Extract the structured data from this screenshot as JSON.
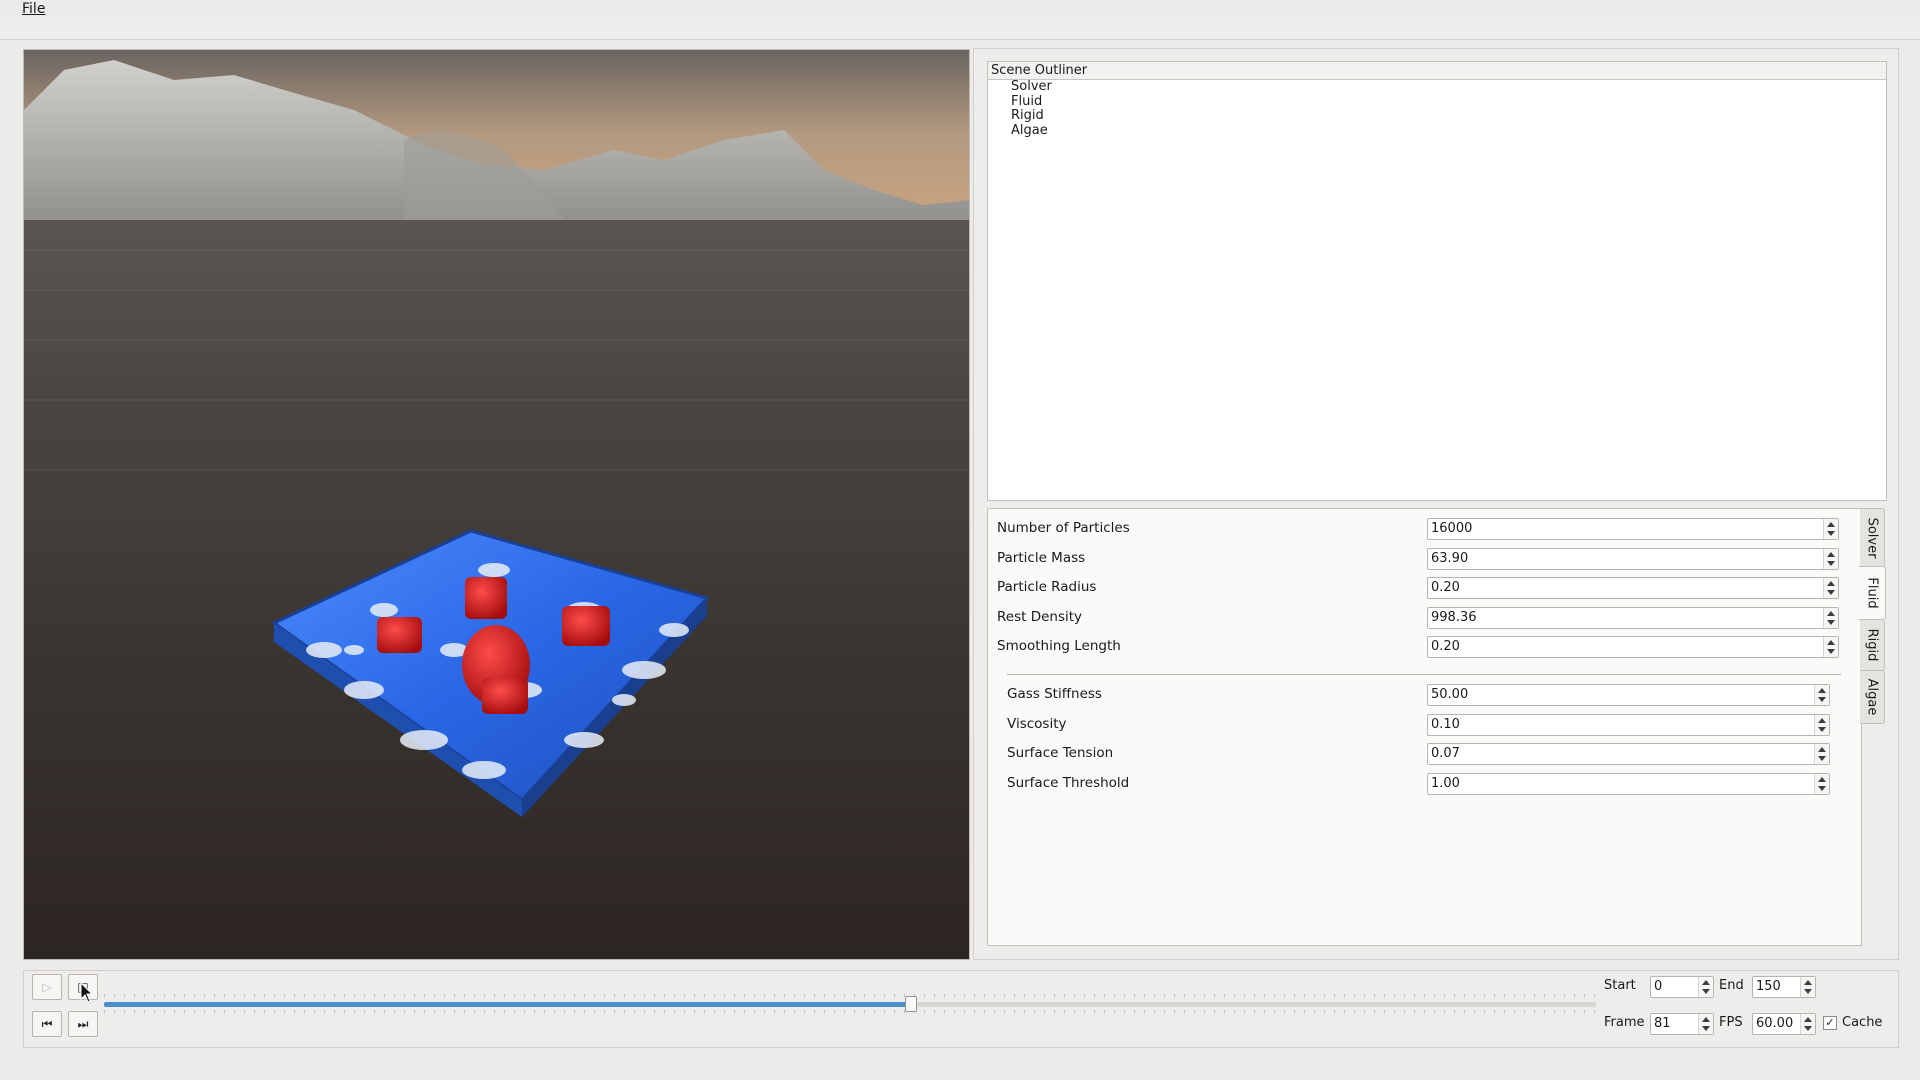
{
  "menubar": {
    "file_label": "File"
  },
  "outliner": {
    "header": "Scene Outliner",
    "items": [
      "Solver",
      "Fluid",
      "Rigid",
      "Algae"
    ]
  },
  "properties": {
    "rows": [
      {
        "label": "Number of Particles",
        "value": "16000"
      },
      {
        "label": "Particle Mass",
        "value": "63.90"
      },
      {
        "label": "Particle Radius",
        "value": "0.20"
      },
      {
        "label": "Rest Density",
        "value": "998.36"
      },
      {
        "label": "Smoothing Length",
        "value": "0.20"
      }
    ],
    "rows2": [
      {
        "label": "Gass Stiffness",
        "value": "50.00"
      },
      {
        "label": "Viscosity",
        "value": "0.10"
      },
      {
        "label": "Surface Tension",
        "value": "0.07"
      },
      {
        "label": "Surface Threshold",
        "value": "1.00"
      }
    ]
  },
  "side_tabs": [
    "Solver",
    "Fluid",
    "Rigid",
    "Algae"
  ],
  "side_tab_active": "Fluid",
  "timeline": {
    "start_label": "Start",
    "start_value": "0",
    "end_label": "End",
    "end_value": "150",
    "frame_label": "Frame",
    "frame_value": "81",
    "fps_label": "FPS",
    "fps_value": "60.00",
    "cache_label": "Cache",
    "cache_checked": true,
    "current_frame": 81,
    "frame_min": 0,
    "frame_max": 150
  },
  "icons": {
    "play": "play-icon",
    "stop": "stop-icon",
    "skip_back": "skip-to-start-icon",
    "skip_forward": "skip-to-end-icon"
  },
  "colors": {
    "accent": "#4a8fc9",
    "fluid": "#2d6fe0",
    "rigid_bodies": "#d81818"
  }
}
